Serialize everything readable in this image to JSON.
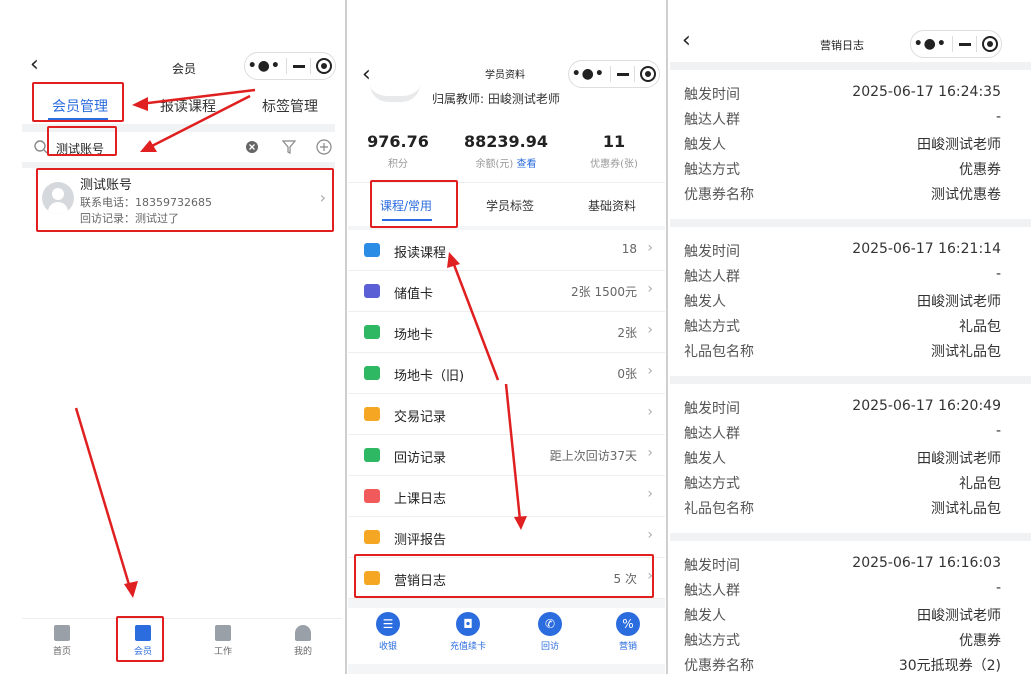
{
  "colors": {
    "accent": "#2b6cde",
    "highlight": "#e02020",
    "divider_gray": "#f1f2f4"
  },
  "member_screen": {
    "nav_title": "会员",
    "tabs": [
      {
        "label": "会员管理"
      },
      {
        "label": "报读课程"
      },
      {
        "label": "标签管理"
      }
    ],
    "search_value": "测试账号",
    "member": {
      "name": "测试账号",
      "phone": "联系电话：18359732685",
      "visit": "回访记录：测试过了"
    },
    "tabbar": [
      {
        "label": "首页"
      },
      {
        "label": "会员"
      },
      {
        "label": "工作"
      },
      {
        "label": "我的"
      }
    ]
  },
  "student_screen": {
    "nav_title": "学员资料",
    "teacher": "归属教师: 田峻测试老师",
    "stats": [
      {
        "value": "976.76",
        "label": "积分"
      },
      {
        "value": "88239.94",
        "label": "余额(元)",
        "link": "查看"
      },
      {
        "value": "11",
        "label": "优惠券(张)"
      }
    ],
    "tabs": [
      {
        "label": "课程/常用"
      },
      {
        "label": "学员标签"
      },
      {
        "label": "基础资料"
      }
    ],
    "menu": [
      {
        "label": "报读课程",
        "value": "18",
        "icon": "course-icon",
        "color": "#2b8ce6"
      },
      {
        "label": "储值卡",
        "value": "2张 1500元",
        "icon": "card-icon",
        "color": "#5b5fd6"
      },
      {
        "label": "场地卡",
        "value": "2张",
        "icon": "venue-card-icon",
        "color": "#2fb864"
      },
      {
        "label": "场地卡（旧)",
        "value": "0张",
        "icon": "venue-card-icon",
        "color": "#2fb864"
      },
      {
        "label": "交易记录",
        "value": "",
        "icon": "transaction-icon",
        "color": "#f5a623"
      },
      {
        "label": "回访记录",
        "value": "距上次回访37天",
        "icon": "visit-icon",
        "color": "#2fb864"
      },
      {
        "label": "上课日志",
        "value": "",
        "icon": "class-log-icon",
        "color": "#f05a5a"
      },
      {
        "label": "测评报告",
        "value": "",
        "icon": "report-icon",
        "color": "#f5a623"
      },
      {
        "label": "营销日志",
        "value": "5 次",
        "icon": "marketing-log-icon",
        "color": "#f5a623"
      }
    ],
    "bottom": [
      {
        "label": "收银",
        "glyph": "☰"
      },
      {
        "label": "充值续卡",
        "glyph": "◘"
      },
      {
        "label": "回访",
        "glyph": "✆"
      },
      {
        "label": "营销",
        "glyph": "%"
      }
    ]
  },
  "log_screen": {
    "nav_title": "营销日志",
    "entries": [
      {
        "rows": [
          {
            "k": "触发时间",
            "v": "2025-06-17 16:24:35"
          },
          {
            "k": "触达人群",
            "v": "-"
          },
          {
            "k": "触发人",
            "v": "田峻测试老师"
          },
          {
            "k": "触达方式",
            "v": "优惠券"
          },
          {
            "k": "优惠券名称",
            "v": "测试优惠卷"
          }
        ]
      },
      {
        "rows": [
          {
            "k": "触发时间",
            "v": "2025-06-17 16:21:14"
          },
          {
            "k": "触达人群",
            "v": "-"
          },
          {
            "k": "触发人",
            "v": "田峻测试老师"
          },
          {
            "k": "触达方式",
            "v": "礼品包"
          },
          {
            "k": "礼品包名称",
            "v": "测试礼品包"
          }
        ]
      },
      {
        "rows": [
          {
            "k": "触发时间",
            "v": "2025-06-17 16:20:49"
          },
          {
            "k": "触达人群",
            "v": "-"
          },
          {
            "k": "触发人",
            "v": "田峻测试老师"
          },
          {
            "k": "触达方式",
            "v": "礼品包"
          },
          {
            "k": "礼品包名称",
            "v": "测试礼品包"
          }
        ]
      },
      {
        "rows": [
          {
            "k": "触发时间",
            "v": "2025-06-17 16:16:03"
          },
          {
            "k": "触达人群",
            "v": "-"
          },
          {
            "k": "触发人",
            "v": "田峻测试老师"
          },
          {
            "k": "触达方式",
            "v": "优惠券"
          },
          {
            "k": "优惠券名称",
            "v": "30元抵现券（2)"
          }
        ]
      }
    ]
  }
}
